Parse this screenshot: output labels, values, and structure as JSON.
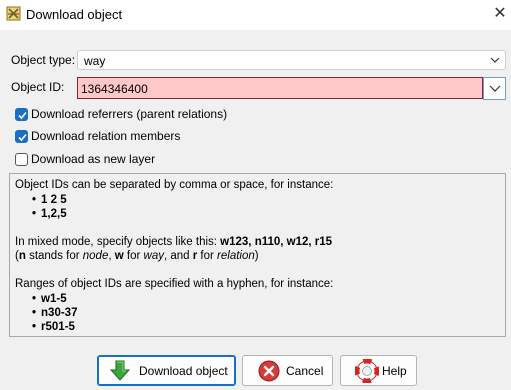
{
  "window": {
    "title": "Download object",
    "close_glyph": "✕",
    "icon": "josm-download-icon"
  },
  "form": {
    "object_type_label": "Object type:",
    "object_type_value": "way",
    "object_id_label": "Object ID:",
    "object_id_value": "1364346400"
  },
  "options": [
    {
      "label": "Download referrers (parent relations)",
      "checked": true
    },
    {
      "label": "Download relation members",
      "checked": true
    },
    {
      "label": "Download as new layer",
      "checked": false
    }
  ],
  "help": {
    "line1": "Object IDs can be separated by comma or space, for instance:",
    "examples1": [
      "1 2 5",
      "1,2,5"
    ],
    "mixed_prefix": "In mixed mode, specify objects like this: ",
    "mixed_example": "w123, n110, w12, r15",
    "legend_open": "(",
    "legend_n": "n",
    "legend_stands_for": " stands for ",
    "legend_node": "node",
    "legend_comma_sep": ", ",
    "legend_w": "w",
    "legend_for": " for ",
    "legend_way": "way",
    "legend_and": ", and ",
    "legend_r": "r",
    "legend_relation": "relation",
    "legend_close": ")",
    "ranges_line": "Ranges of object IDs are specified with a hyphen, for instance:",
    "examples2": [
      "w1-5",
      "n30-37",
      "r501-5"
    ]
  },
  "buttons": {
    "download": "Download object",
    "cancel": "Cancel",
    "help": "Help"
  },
  "colors": {
    "accent": "#1a6fc4",
    "invalid_field_bg": "#ffc8c8",
    "invalid_field_border": "#8a2030"
  }
}
